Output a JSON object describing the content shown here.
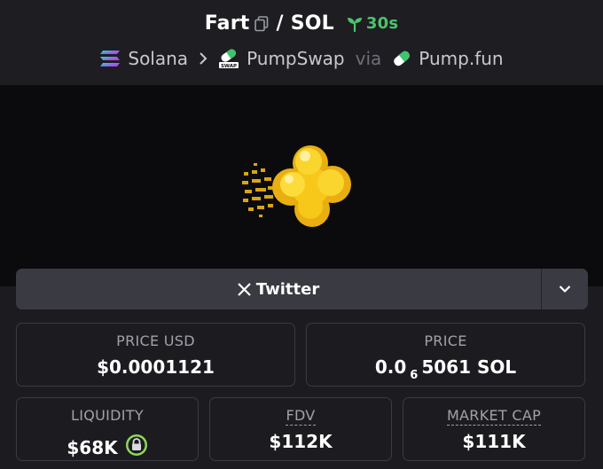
{
  "pair": {
    "base": "Fart",
    "separator": "/",
    "quote": "SOL",
    "age": "30s"
  },
  "route": {
    "chain": "Solana",
    "dex": "PumpSwap",
    "via": "via",
    "launchpad": "Pump.fun"
  },
  "socials": {
    "twitter_label": "Twitter"
  },
  "stats": {
    "price_usd": {
      "label": "PRICE USD",
      "value": "$0.0001121"
    },
    "price_native": {
      "label": "PRICE",
      "prefix": "0.0",
      "zeros": "6",
      "suffix": "5061 SOL"
    },
    "liquidity": {
      "label": "LIQUIDITY",
      "value": "$68K"
    },
    "fdv": {
      "label": "FDV",
      "value": "$112K"
    },
    "market_cap": {
      "label": "MARKET CAP",
      "value": "$111K"
    }
  },
  "colors": {
    "accent_green": "#4cc36a",
    "token_yellow": "#f7c81a"
  }
}
